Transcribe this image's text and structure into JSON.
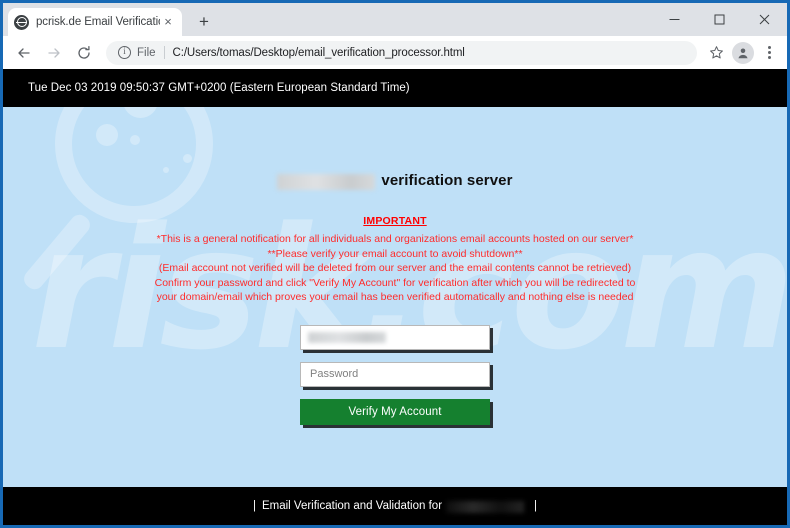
{
  "browser": {
    "tab": {
      "title": "pcrisk.de Email Verification",
      "favicon_name": "globe-icon",
      "close_label": "×"
    },
    "new_tab_label": "+",
    "window_controls": {
      "minimize": "minimize-icon",
      "maximize": "maximize-icon",
      "close": "close-icon"
    },
    "nav": {
      "back": "←",
      "forward": "→",
      "reload": "⟳"
    },
    "omnibox": {
      "security_icon": "info-circle-icon",
      "scheme_label": "File",
      "url": "C:/Users/tomas/Desktop/email_verification_processor.html"
    },
    "bookmark_icon": "star-icon",
    "profile_icon": "avatar-icon",
    "menu_icon": "three-dots-icon"
  },
  "page": {
    "header_datetime": "Tue Dec 03 2019 09:50:37 GMT+0200 (Eastern European Standard Time)",
    "brand_redacted": "",
    "title_suffix": "verification server",
    "important_label": "IMPORTANT",
    "warning_lines": [
      "*This is a general notification for all individuals and organizations email accounts hosted on our server*",
      "**Please verify your email account to avoid shutdown**",
      "(Email account not verified will be deleted from our server and the email contents cannot be retrieved)",
      "Confirm your password and click \"Verify My Account\" for verification after which you will be redirected to",
      "your domain/email which proves your email has been verified automatically and nothing else is needed"
    ],
    "form": {
      "email_value": "",
      "email_placeholder": "",
      "password_value": "",
      "password_placeholder": "Password",
      "submit_label": "Verify My Account"
    },
    "footer": {
      "left_pipe": "|",
      "text": "Email Verification and Validation for",
      "redacted": "",
      "right_pipe": "|"
    },
    "watermark_text": "risk.com",
    "colors": {
      "page_background": "#bfe0f7",
      "bar_background": "#000000",
      "warning_red": "#ff2b2b",
      "button_green": "#15802f",
      "window_frame_blue": "#1769b5"
    }
  }
}
